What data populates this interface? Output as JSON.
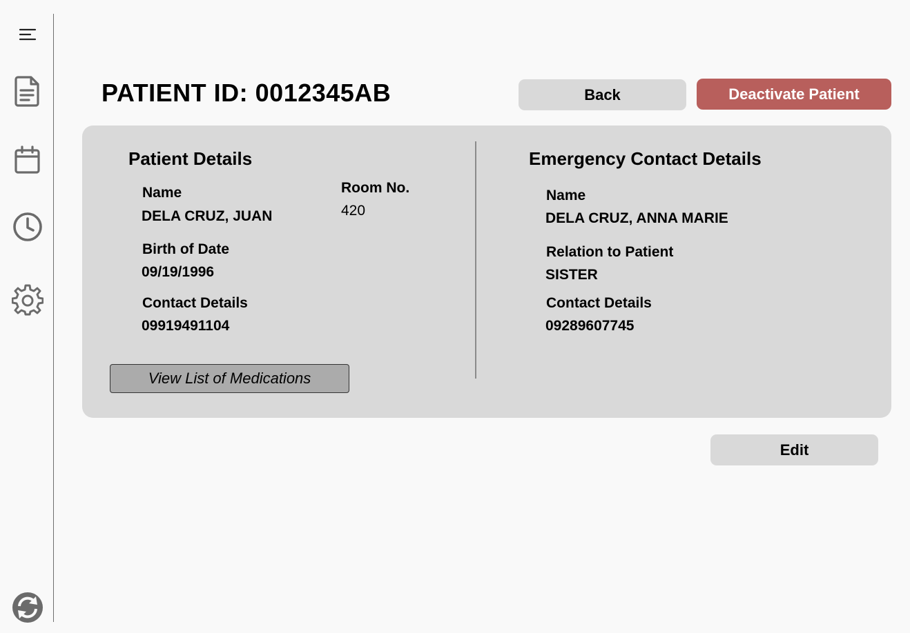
{
  "header": {
    "title": "PATIENT ID: 0012345AB",
    "back_label": "Back",
    "deactivate_label": "Deactivate Patient"
  },
  "sidebar": {
    "icons": [
      "menu-icon",
      "document-icon",
      "calendar-icon",
      "clock-icon",
      "gear-icon",
      "sync-icon"
    ]
  },
  "patient": {
    "section_title": "Patient Details",
    "name_label": "Name",
    "name_value": "DELA CRUZ, JUAN",
    "room_label": "Room No.",
    "room_value": "420",
    "birth_label": "Birth of Date",
    "birth_value": "09/19/1996",
    "contact_label": "Contact Details",
    "contact_value": "09919491104",
    "medications_button": "View List of Medications"
  },
  "emergency": {
    "section_title": "Emergency Contact Details",
    "name_label": "Name",
    "name_value": "DELA CRUZ, ANNA MARIE",
    "relation_label": "Relation to Patient",
    "relation_value": "SISTER",
    "contact_label": "Contact Details",
    "contact_value": "09289607745"
  },
  "footer": {
    "edit_label": "Edit"
  },
  "colors": {
    "background": "#f9f9f9",
    "card": "#d9d9d9",
    "danger": "#b85f5c",
    "secondary_button": "#d9d9d9",
    "medications_button": "#ababab",
    "icon": "#6b6b6b"
  }
}
